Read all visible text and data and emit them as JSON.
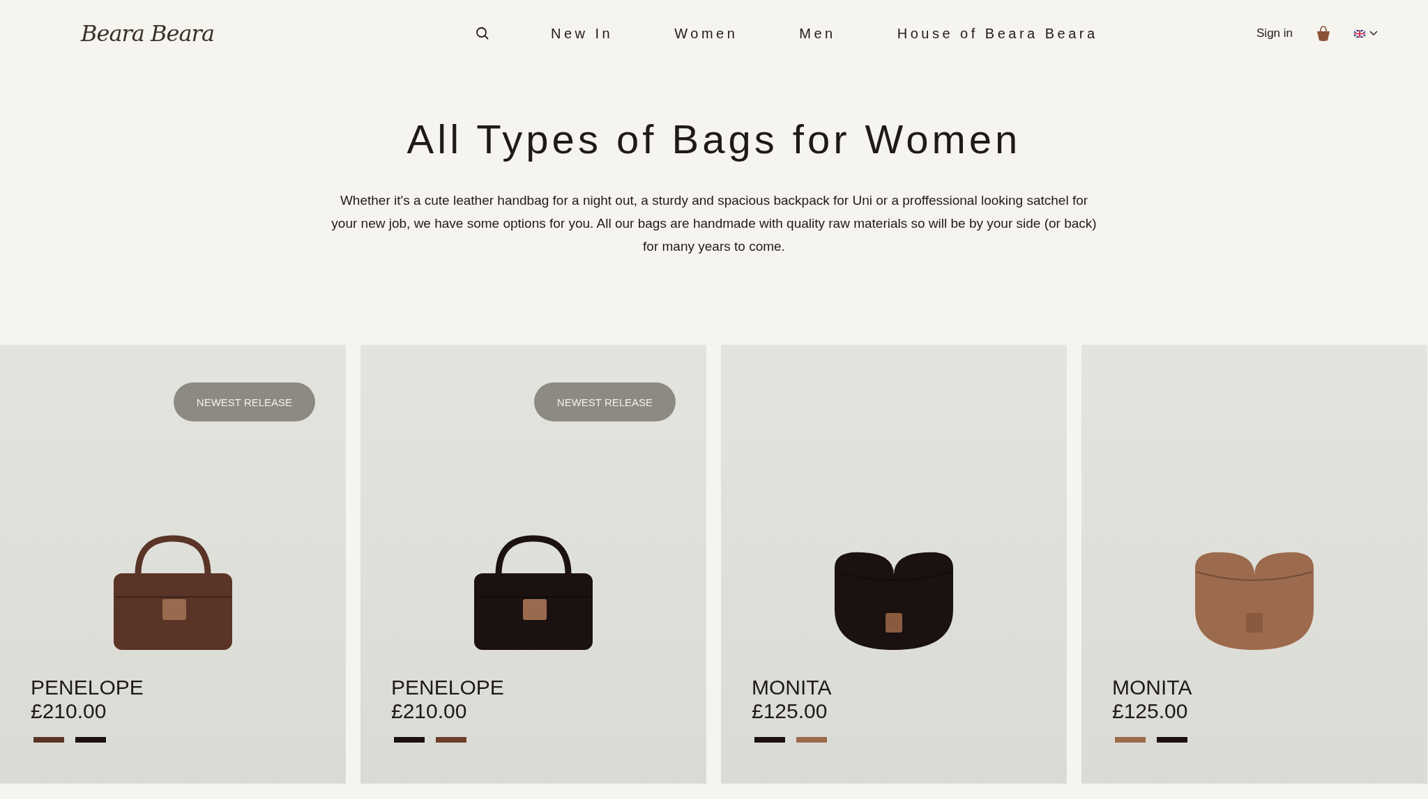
{
  "header": {
    "logo": "Beara Beara",
    "nav": [
      "New In",
      "Women",
      "Men",
      "House of Beara Beara"
    ],
    "sign_in": "Sign in"
  },
  "intro": {
    "title": "All Types of Bags for Women",
    "text": "Whether it's a cute leather handbag for a night out, a sturdy and spacious backpack for Uni or a proffessional looking satchel for your new job, we have some options for you. All our bags are handmade with quality raw materials so will be by your side (or back) for many years to come."
  },
  "products": [
    {
      "kind": "top-handle",
      "badge": "NEWEST RELEASE",
      "name": "PENELOPE",
      "price": "£210.00",
      "swatches": [
        {
          "color": "#5a3426"
        },
        {
          "color": "#1a1110"
        }
      ]
    },
    {
      "kind": "top-handle",
      "badge": "NEWEST RELEASE",
      "name": "PENELOPE",
      "price": "£210.00",
      "swatches": [
        {
          "color": "#1a1110"
        },
        {
          "color": "#6e3e2c"
        }
      ]
    },
    {
      "kind": "saddle",
      "name": "MONITA",
      "price": "£125.00",
      "swatches": [
        {
          "color": "#1a1110"
        },
        {
          "color": "#9c6a4c"
        }
      ]
    },
    {
      "kind": "saddle",
      "name": "MONITA",
      "price": "£125.00",
      "swatches": [
        {
          "color": "#9c6a4c"
        },
        {
          "color": "#1a1110"
        }
      ]
    }
  ]
}
